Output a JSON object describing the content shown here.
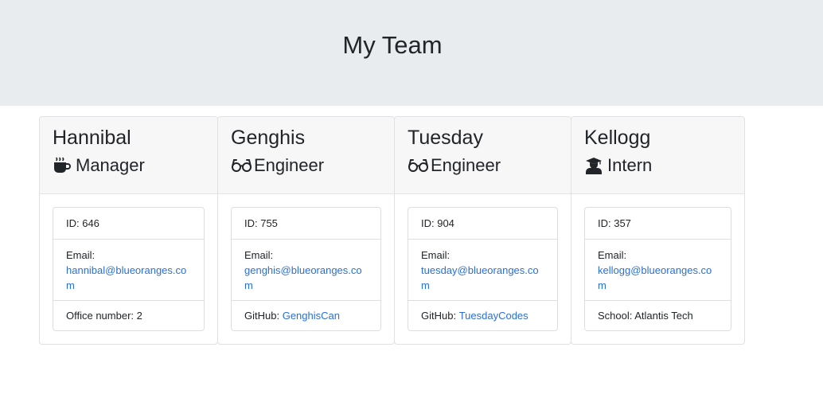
{
  "header": {
    "title": "My Team"
  },
  "team": [
    {
      "name": "Hannibal",
      "role": "Manager",
      "icon": "coffee-icon",
      "id": "ID: 646",
      "email_label": "Email:",
      "email": "hannibal@blueoranges.com",
      "extra_label": "Office number: 2",
      "extra_link": ""
    },
    {
      "name": "Genghis",
      "role": "Engineer",
      "icon": "glasses-icon",
      "id": "ID: 755",
      "email_label": "Email:",
      "email": "genghis@blueoranges.com",
      "extra_label": "GitHub:",
      "extra_link": "GenghisCan"
    },
    {
      "name": "Tuesday",
      "role": "Engineer",
      "icon": "glasses-icon",
      "id": "ID: 904",
      "email_label": "Email:",
      "email": "tuesday@blueoranges.com",
      "extra_label": "GitHub:",
      "extra_link": "TuesdayCodes"
    },
    {
      "name": "Kellogg",
      "role": "Intern",
      "icon": "graduate-icon",
      "id": "ID: 357",
      "email_label": "Email:",
      "email": "kellogg@blueoranges.com",
      "extra_label": "School: Atlantis Tech",
      "extra_link": ""
    }
  ],
  "colors": {
    "header_bg": "#e9ecef",
    "link": "#2a6fd9",
    "card_header_bg": "#f7f7f7"
  }
}
